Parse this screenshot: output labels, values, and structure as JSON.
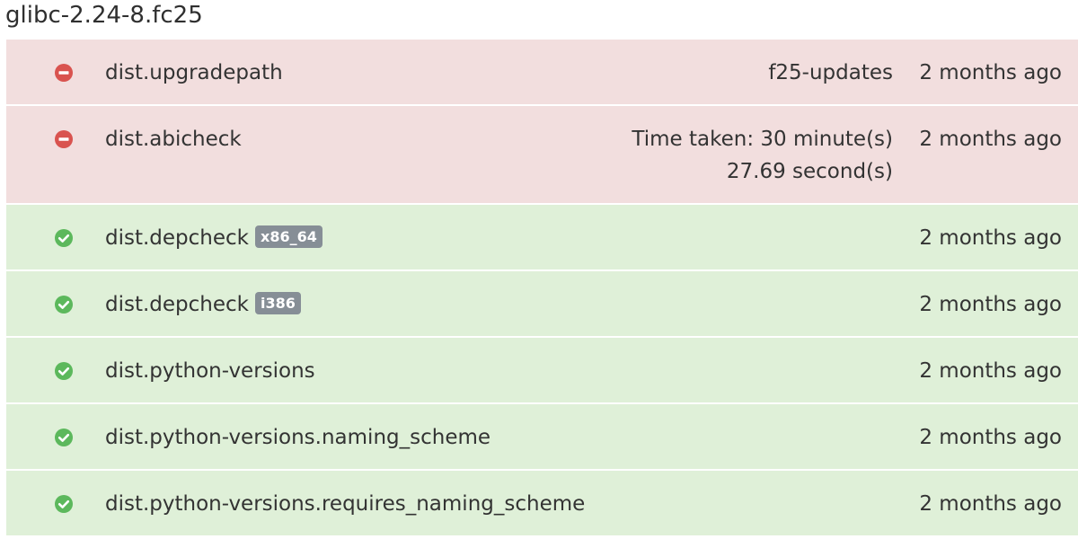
{
  "page": {
    "title": "glibc-2.24-8.fc25"
  },
  "colors": {
    "failed_row_bg": "#f2dede",
    "passed_row_bg": "#dff0d8",
    "failed_icon": "#d9534f",
    "passed_icon": "#5cb85c",
    "badge_bg": "#868e96"
  },
  "results": [
    {
      "status": "failed",
      "icon": "minus-circle-icon",
      "testcase": "dist.upgradepath",
      "badge": null,
      "note_lines": [
        "f25-updates"
      ],
      "time": "2 months ago"
    },
    {
      "status": "failed",
      "icon": "minus-circle-icon",
      "testcase": "dist.abicheck",
      "badge": null,
      "note_lines": [
        "Time taken: 30 minute(s)",
        "27.69 second(s)"
      ],
      "time": "2 months ago"
    },
    {
      "status": "passed",
      "icon": "check-circle-icon",
      "testcase": "dist.depcheck",
      "badge": "x86_64",
      "note_lines": [],
      "time": "2 months ago"
    },
    {
      "status": "passed",
      "icon": "check-circle-icon",
      "testcase": "dist.depcheck",
      "badge": "i386",
      "note_lines": [],
      "time": "2 months ago"
    },
    {
      "status": "passed",
      "icon": "check-circle-icon",
      "testcase": "dist.python-versions",
      "badge": null,
      "note_lines": [],
      "time": "2 months ago"
    },
    {
      "status": "passed",
      "icon": "check-circle-icon",
      "testcase": "dist.python-versions.naming_scheme",
      "badge": null,
      "note_lines": [],
      "time": "2 months ago"
    },
    {
      "status": "passed",
      "icon": "check-circle-icon",
      "testcase": "dist.python-versions.requires_naming_scheme",
      "badge": null,
      "note_lines": [],
      "time": "2 months ago"
    }
  ]
}
